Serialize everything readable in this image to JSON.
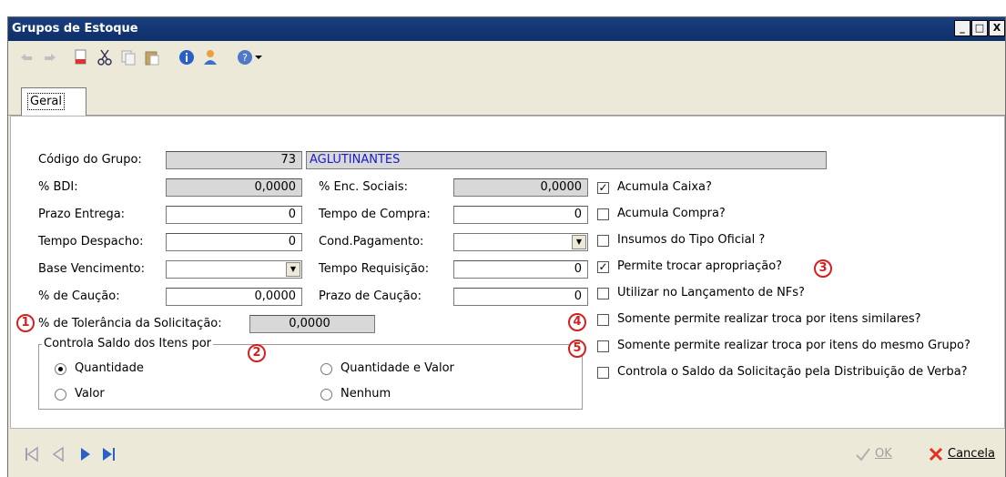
{
  "window": {
    "title": "Grupos de Estoque",
    "buttons": [
      "_",
      "□",
      "X"
    ]
  },
  "toolbar": {
    "icons": [
      "undo-icon",
      "redo-icon",
      "new-doc-icon",
      "cut-icon",
      "copy-icon",
      "paste-icon",
      "info-icon",
      "user-icon",
      "help-icon",
      "dropdown-arrow-icon"
    ]
  },
  "tabs": {
    "geral": "Geral"
  },
  "form": {
    "codigo_label": "Código do Grupo:",
    "codigo_value": "73",
    "codigo_desc": "AGLUTINANTES",
    "bdi_label": "% BDI:",
    "bdi_value": "0,0000",
    "enc_label": "% Enc. Sociais:",
    "enc_value": "0,0000",
    "prazo_entrega_label": "Prazo Entrega:",
    "prazo_entrega_value": "0",
    "tempo_compra_label": "Tempo de Compra:",
    "tempo_compra_value": "0",
    "tempo_despacho_label": "Tempo Despacho:",
    "tempo_despacho_value": "0",
    "cond_pag_label": "Cond.Pagamento:",
    "cond_pag_value": "",
    "base_venc_label": "Base Vencimento:",
    "base_venc_value": "",
    "tempo_req_label": "Tempo Requisição:",
    "tempo_req_value": "0",
    "caucao_label": "% de Caução:",
    "caucao_value": "0,0000",
    "prazo_caucao_label": "Prazo de Caução:",
    "prazo_caucao_value": "0",
    "tolerancia_label": "% de Tolerância da Solicitação:",
    "tolerancia_value": "0,0000"
  },
  "group": {
    "title": "Controla Saldo dos Itens por",
    "options": [
      {
        "label": "Quantidade",
        "selected": true
      },
      {
        "label": "Quantidade e Valor",
        "selected": false
      },
      {
        "label": "Valor",
        "selected": false
      },
      {
        "label": "Nenhum",
        "selected": false
      }
    ]
  },
  "checks": [
    {
      "label": "Acumula Caixa?",
      "checked": true
    },
    {
      "label": "Acumula Compra?",
      "checked": false
    },
    {
      "label": "Insumos do Tipo Oficial ?",
      "checked": false
    },
    {
      "label": "Permite trocar apropriação?",
      "checked": true
    },
    {
      "label": "Utilizar no Lançamento de NFs?",
      "checked": false
    },
    {
      "label": "Somente permite realizar troca por itens similares?",
      "checked": false
    },
    {
      "label": "Somente permite realizar troca por itens do mesmo Grupo?",
      "checked": false
    },
    {
      "label": "Controla o Saldo da Solicitação pela Distribuição de Verba?",
      "checked": false
    }
  ],
  "callouts": [
    "1",
    "2",
    "3",
    "4",
    "5"
  ],
  "bottom": {
    "ok": "OK",
    "cancel": "Cancela"
  },
  "colors": {
    "title_bg": "#0d2f6a",
    "desc_text": "#1a1ad0",
    "callout": "#d42020"
  }
}
